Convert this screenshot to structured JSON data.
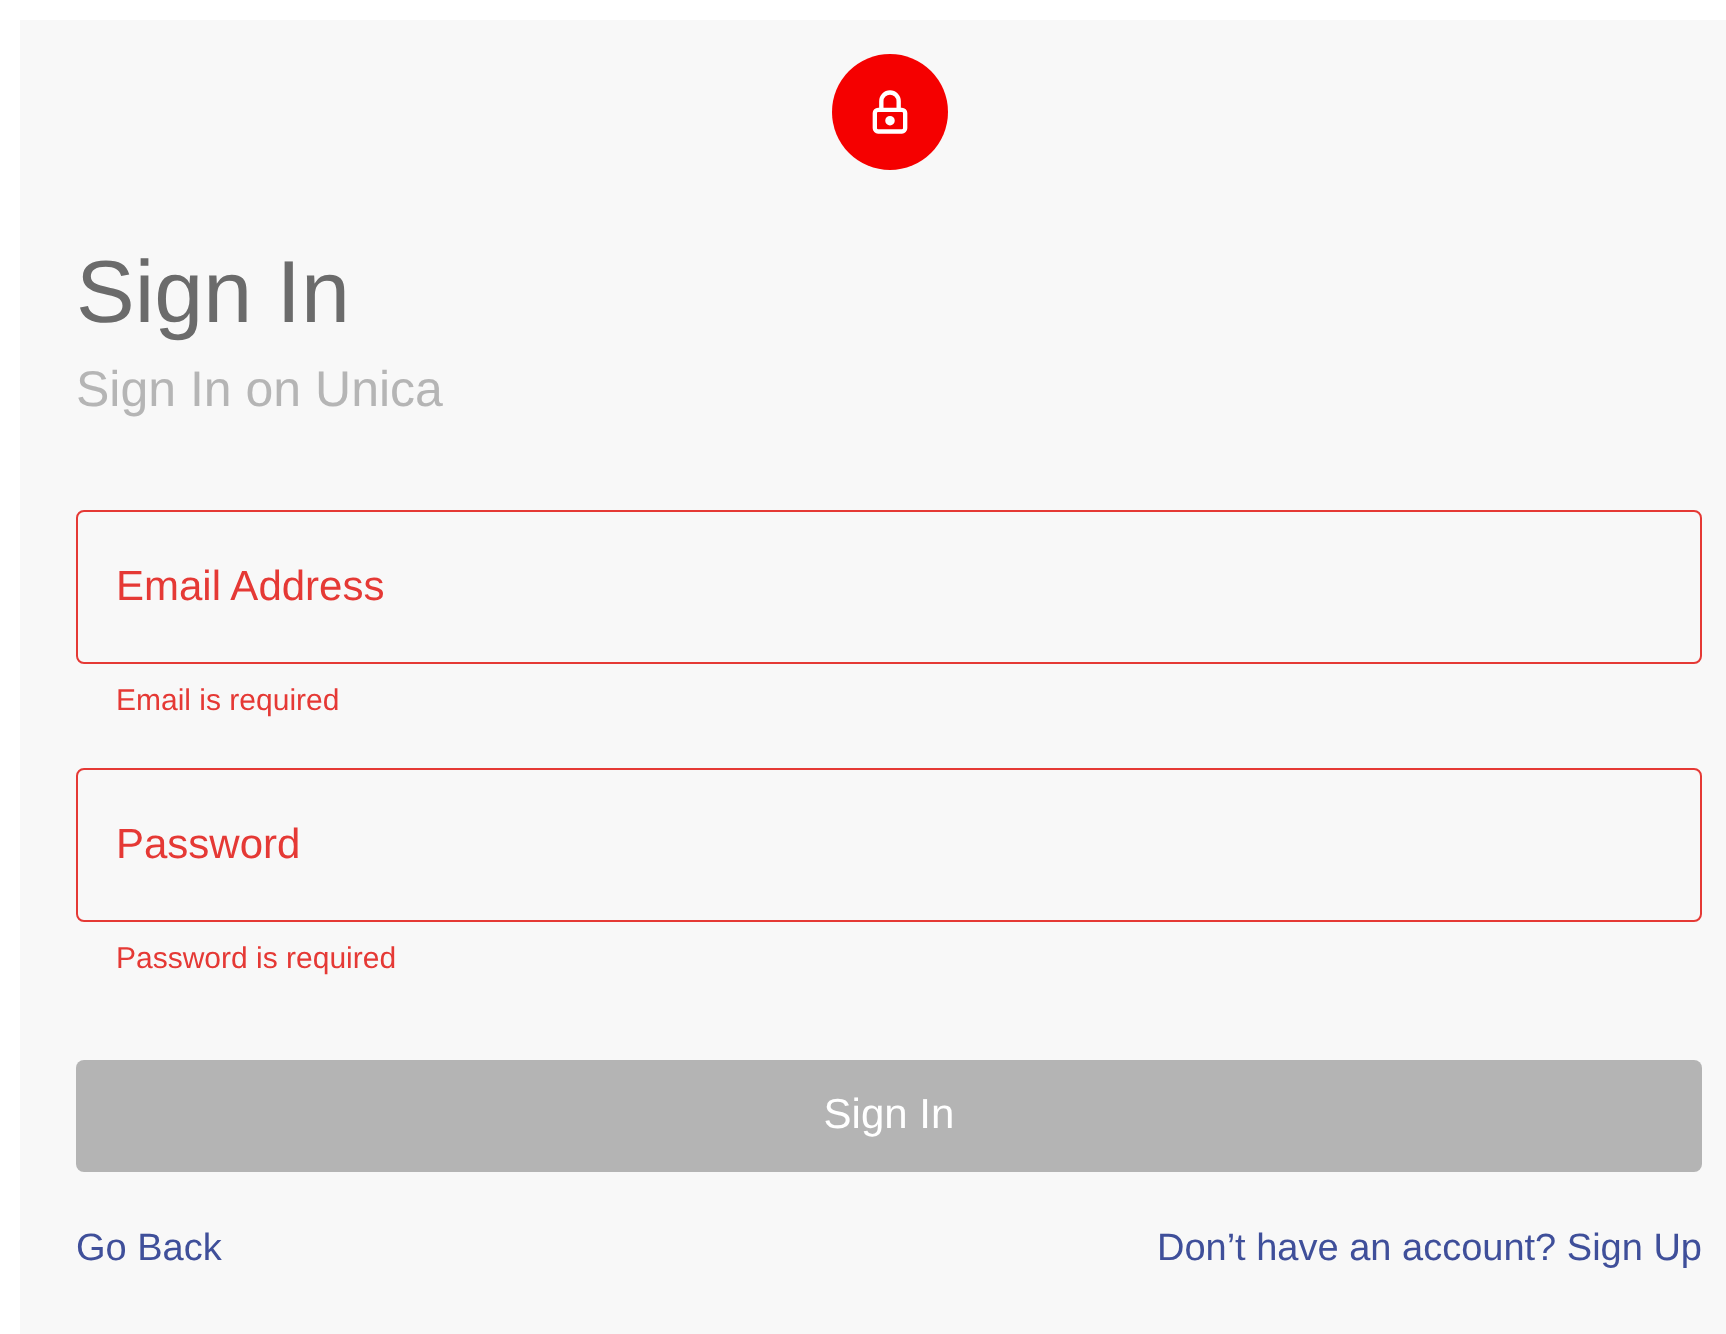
{
  "title": "Sign In",
  "subtitle": "Sign In on Unica",
  "fields": [
    {
      "placeholder": "Email Address",
      "error": true,
      "message": "Email is required"
    },
    {
      "placeholder": "Password",
      "error": true,
      "message": "Password is required"
    }
  ],
  "submit": {
    "label": "Sign In",
    "disabled": true
  },
  "links": {
    "back": "Go Back",
    "signup": "Don’t have an account? Sign Up"
  }
}
